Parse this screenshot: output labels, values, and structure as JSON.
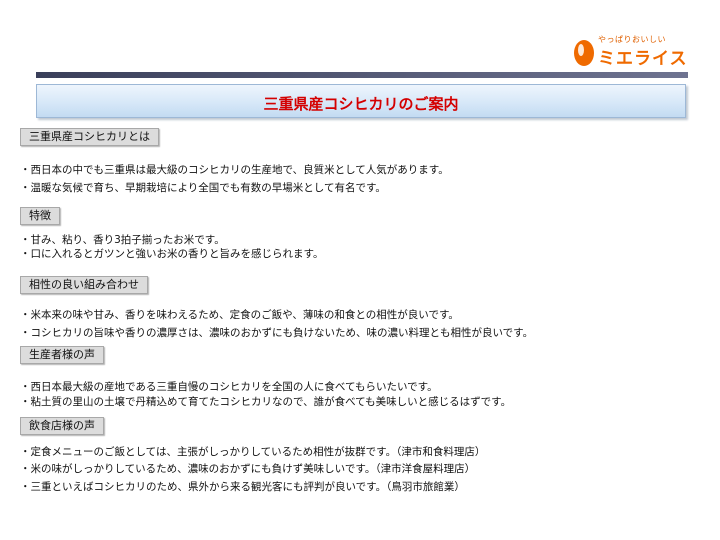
{
  "logo": {
    "tagline": "やっぱりおいしい",
    "name": "ミエライス",
    "brand_color": "#ef6a00"
  },
  "title": "三重県産コシヒカリのご案内",
  "title_color": "#d40000",
  "sections": [
    {
      "heading": "三重県産コシヒカリとは",
      "lines": [
        "・西日本の中でも三重県は最大級のコシヒカリの生産地で、良質米として人気があります。",
        "・温暖な気候で育ち、早期栽培により全国でも有数の早場米として有名です。"
      ]
    },
    {
      "heading": "特徴",
      "lines": [
        "・甘み、粘り、香り3拍子揃ったお米です。",
        "・口に入れるとガツンと強いお米の香りと旨みを感じられます。"
      ]
    },
    {
      "heading": "相性の良い組み合わせ",
      "lines": [
        "・米本来の味や甘み、香りを味わえるため、定食のご飯や、薄味の和食との相性が良いです。",
        "・コシヒカリの旨味や香りの濃厚さは、濃味のおかずにも負けないため、味の濃い料理とも相性が良いです。"
      ]
    },
    {
      "heading": "生産者様の声",
      "lines": [
        "・西日本最大級の産地である三重自慢のコシヒカリを全国の人に食べてもらいたいです。",
        "・粘土質の里山の土壌で丹精込めて育てたコシヒカリなので、誰が食べても美味しいと感じるはずです。"
      ]
    },
    {
      "heading": "飲食店様の声",
      "lines": [
        "・定食メニューのご飯としては、主張がしっかりしているため相性が抜群です。（津市和食料理店）",
        "・米の味がしっかりしているため、濃味のおかずにも負けず美味しいです。（津市洋食屋料理店）",
        "・三重といえばコシヒカリのため、県外から来る観光客にも評判が良いです。（鳥羽市旅館業）"
      ]
    }
  ]
}
